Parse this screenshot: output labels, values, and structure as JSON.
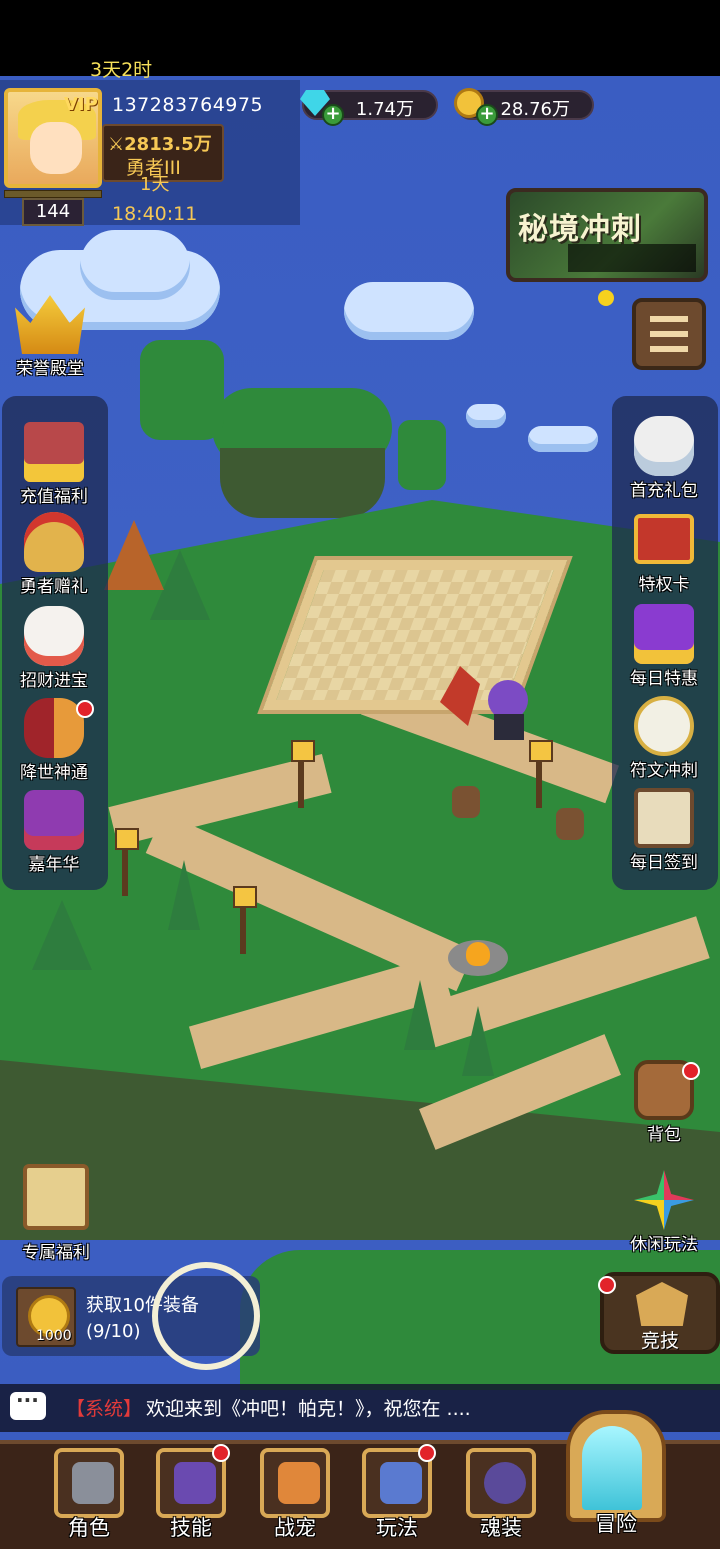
{
  "player": {
    "uid": "137283764975",
    "vip_label": "VIP",
    "power": "2813.5万",
    "rank": "勇者III",
    "days": "1天",
    "time": "18:40:11",
    "level": "144"
  },
  "currencies": {
    "gems": "1.74万",
    "gold": "28.76万"
  },
  "event": {
    "title": "秘境冲刺",
    "timer": "3天2时"
  },
  "left_menu": {
    "honor_hall": "荣誉殿堂",
    "items": [
      "充值福利",
      "勇者赠礼",
      "招财进宝",
      "降世神通",
      "嘉年华"
    ],
    "exclusive_welfare": "专属福利"
  },
  "right_menu": {
    "items": [
      "首充礼包",
      "特权卡",
      "每日特惠",
      "符文冲刺",
      "每日签到"
    ],
    "backpack": "背包",
    "leisure": "休闲玩法",
    "arena": "竞技"
  },
  "task": {
    "coin_amount": "1000",
    "title": "获取10件装备",
    "progress": "(9/10)"
  },
  "chat": {
    "tag": "【系统】",
    "message": "欢迎来到《冲吧！帕克！》，祝您在 ...."
  },
  "bottom_nav": {
    "character": "角色",
    "skills": "技能",
    "pets": "战宠",
    "gameplay": "玩法",
    "soul_gear": "魂装",
    "adventure": "冒险"
  },
  "colors": {
    "sky": "#3f62c6",
    "grass": "#2f8a3b",
    "gold_text": "#f6c855",
    "notify_red": "#e2232a"
  }
}
